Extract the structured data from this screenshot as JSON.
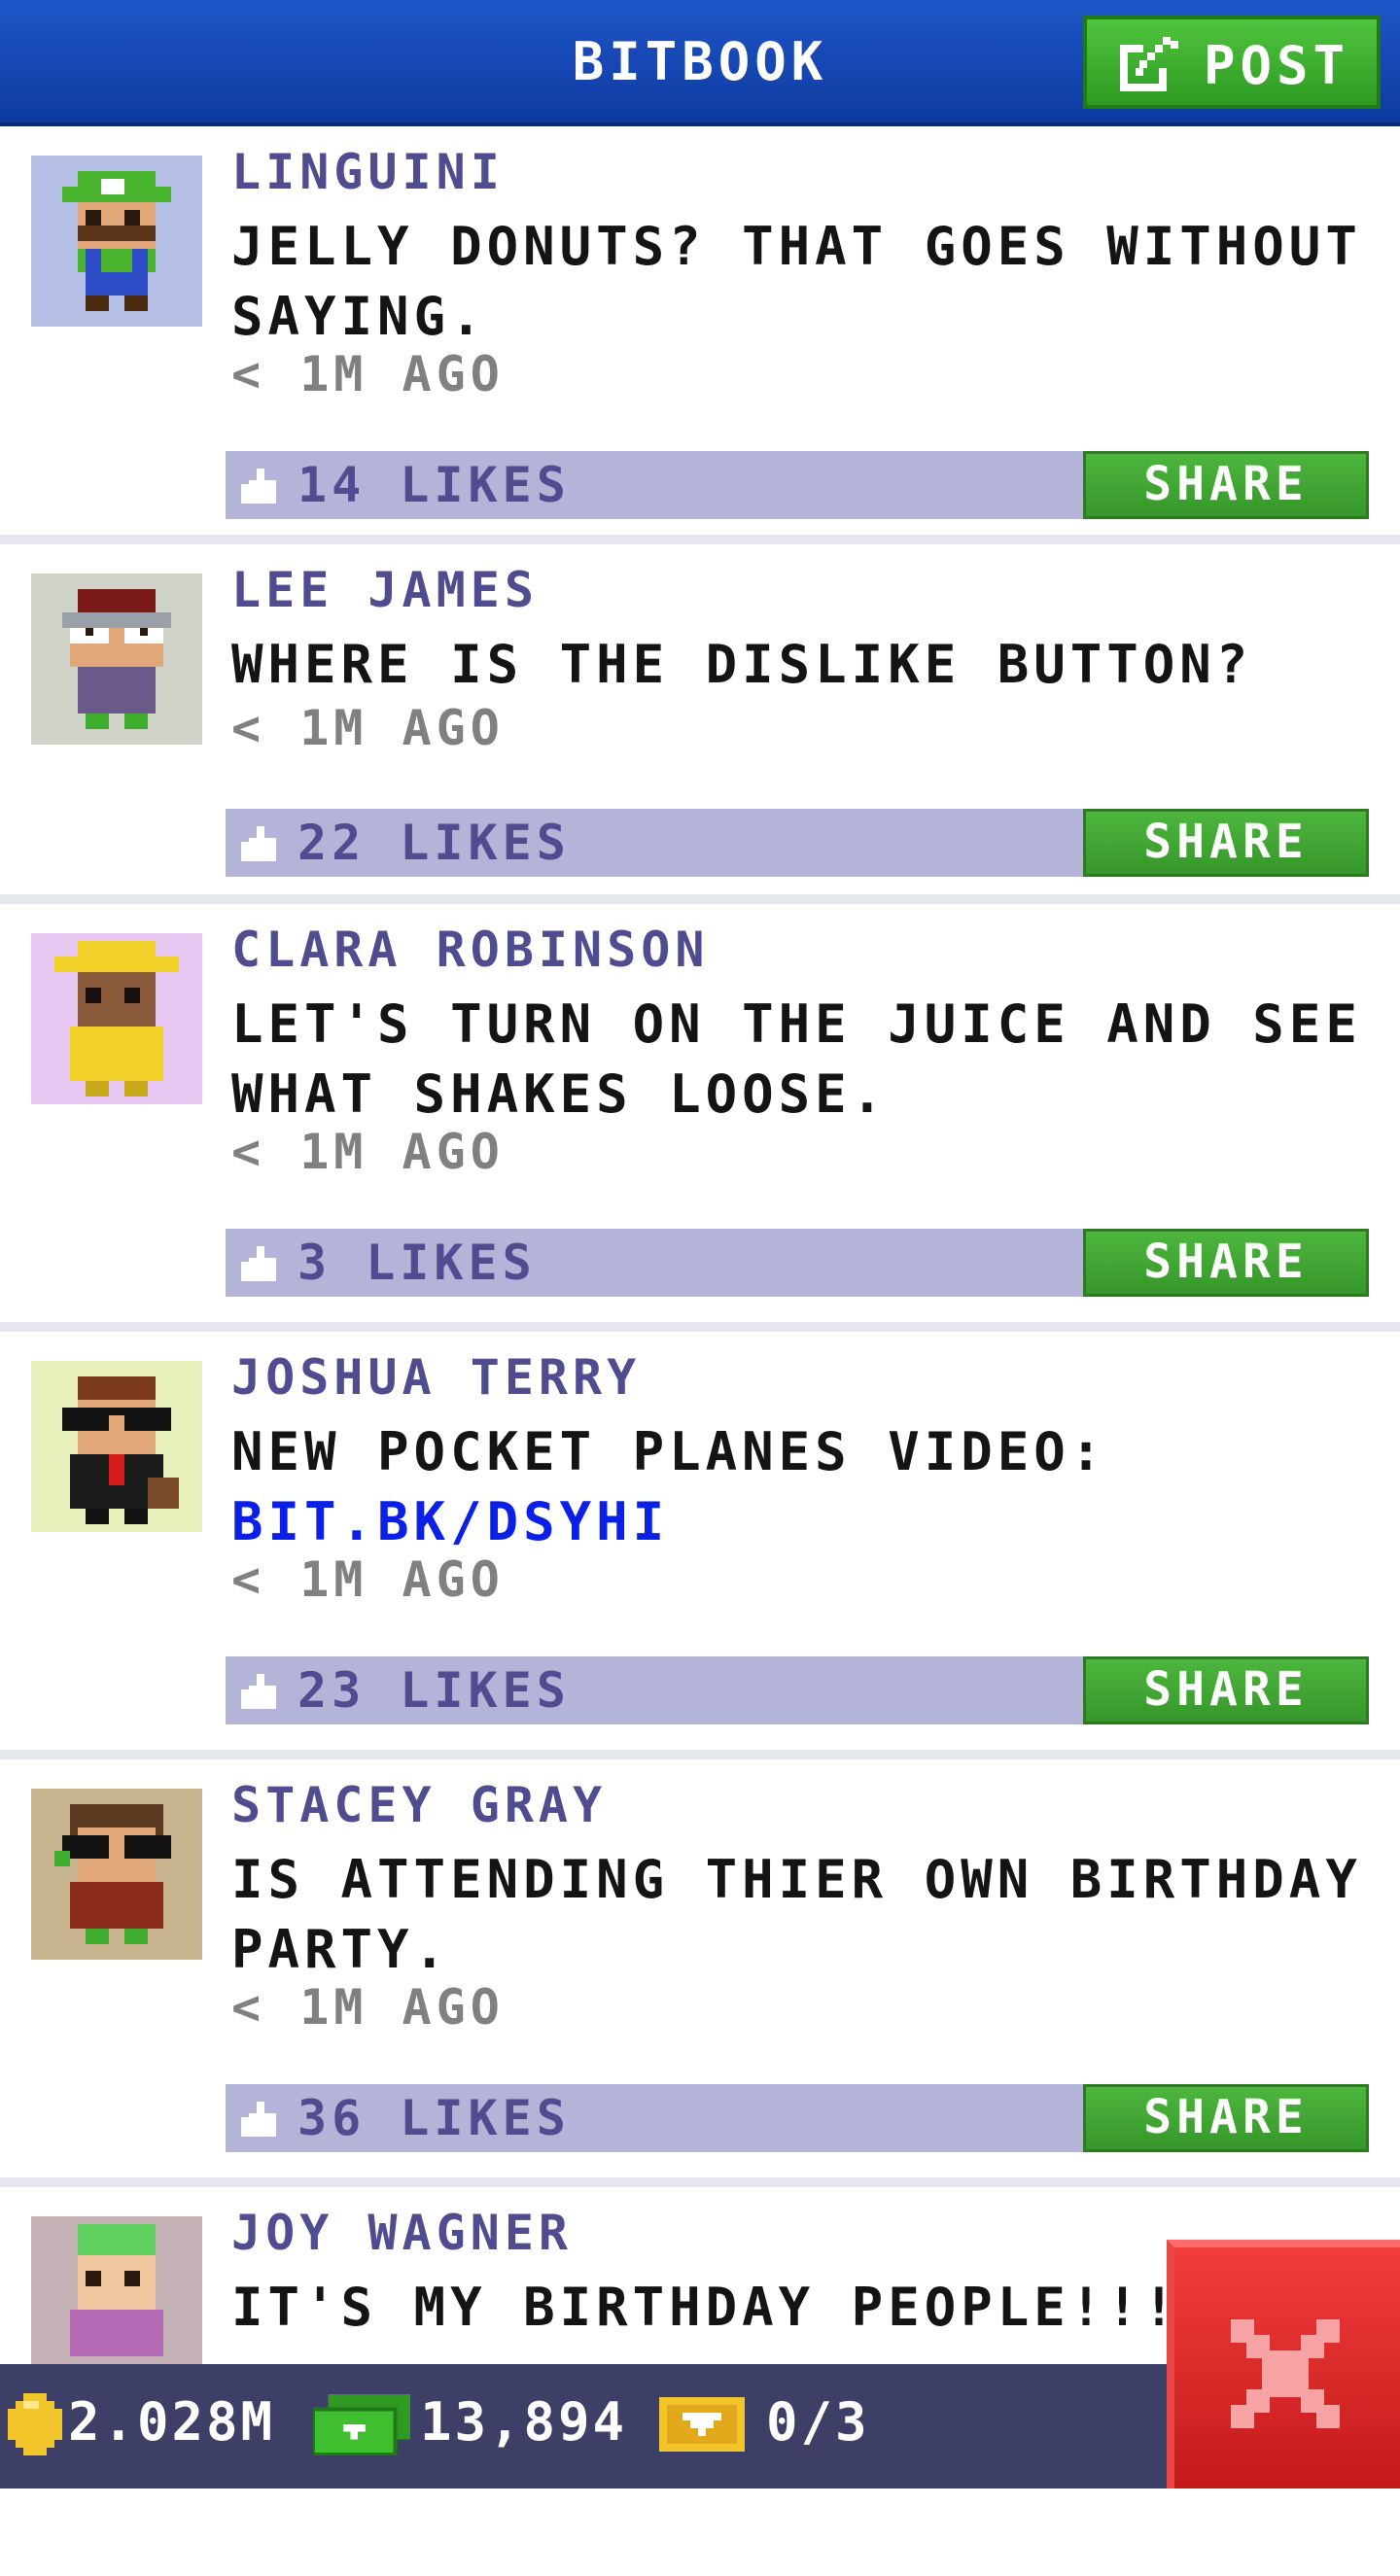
{
  "header": {
    "title": "BITBOOK",
    "post_label": "POST"
  },
  "posts": [
    {
      "name": "LINGUINI",
      "text": "JELLY DONUTS? THAT GOES WITHOUT SAYING.",
      "time": "< 1M AGO",
      "likes": "14 LIKES",
      "share_label": "SHARE"
    },
    {
      "name": "LEE JAMES",
      "text": "WHERE IS THE DISLIKE BUTTON?",
      "time": "< 1M AGO",
      "likes": "22 LIKES",
      "share_label": "SHARE"
    },
    {
      "name": "CLARA ROBINSON",
      "text": "LET'S TURN ON THE JUICE AND SEE WHAT SHAKES LOOSE.",
      "time": "< 1M AGO",
      "likes": "3 LIKES",
      "share_label": "SHARE"
    },
    {
      "name": "JOSHUA TERRY",
      "text": "NEW POCKET PLANES VIDEO:",
      "link": "BIT.BK/DSYHI",
      "time": "< 1M AGO",
      "likes": "23 LIKES",
      "share_label": "SHARE"
    },
    {
      "name": "STACEY GRAY",
      "text": "IS ATTENDING THIER OWN BIRTHDAY PARTY.",
      "time": "< 1M AGO",
      "likes": "36 LIKES",
      "share_label": "SHARE"
    },
    {
      "name": "JOY WAGNER",
      "text": "IT'S MY BIRTHDAY PEOPLE!!! COM"
    }
  ],
  "status_bar": {
    "coins": "2.028M",
    "bux": "13,894",
    "tickets": "0/3"
  },
  "colors": {
    "header_blue": "#1f56c8",
    "accent_green": "#3fae2f",
    "name_purple": "#4f4c8f",
    "likes_bar": "#b3b4d7",
    "link_blue": "#0a1fe8",
    "close_red": "#e02a2a"
  },
  "icons": {
    "post": "edit-icon",
    "like": "thumbs-up-icon",
    "coin": "coin-icon",
    "bux": "cash-icon",
    "ticket": "ticket-icon",
    "close": "close-icon"
  }
}
